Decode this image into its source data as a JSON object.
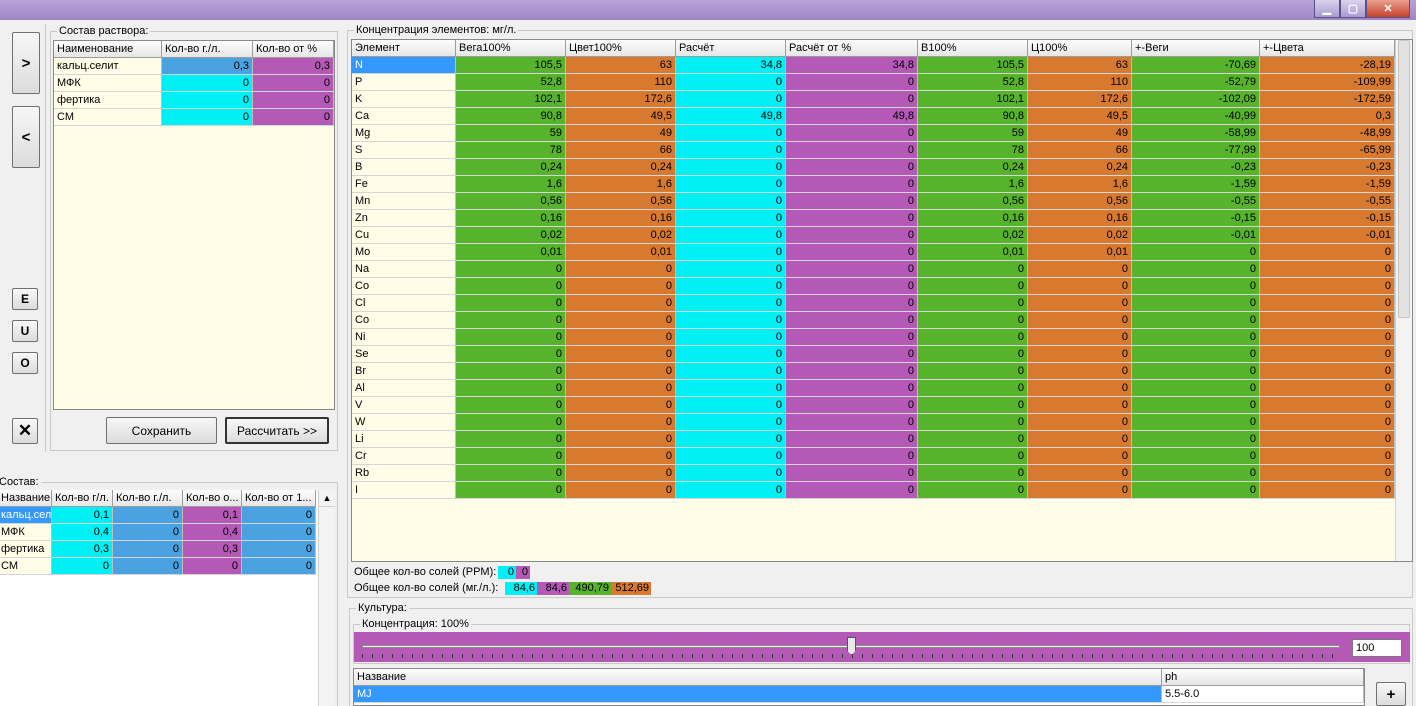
{
  "window": {
    "min_symbol": "▁",
    "max_symbol": "▢",
    "close_symbol": "✕"
  },
  "toolbar": {
    "add_label": ">",
    "remove_label": "<",
    "e_label": "E",
    "u_label": "U",
    "o_label": "O",
    "close_label": "✕"
  },
  "composition": {
    "title": "Состав раствора:",
    "headers": [
      "Наименование",
      "Кол-во г./л.",
      "Кол-во от %"
    ],
    "rows": [
      {
        "name": "кальц.селит",
        "g": "0,3",
        "pct": "0,3"
      },
      {
        "name": "МФК",
        "g": "0",
        "pct": "0"
      },
      {
        "name": "фертика",
        "g": "0",
        "pct": "0"
      },
      {
        "name": "СМ",
        "g": "0",
        "pct": "0"
      }
    ],
    "save_label": "Сохранить",
    "calc_label": "Рассчитать >>"
  },
  "sostav": {
    "title": "Состав:",
    "headers": [
      "Название",
      "Кол-во г/л.",
      "Кол-во г./л.",
      "Кол-во о...",
      "Кол-во от 1..."
    ],
    "rows": [
      {
        "name": "кальц.селит",
        "a": "0,1",
        "b": "0",
        "c": "0,1",
        "d": "0"
      },
      {
        "name": "МФК",
        "a": "0,4",
        "b": "0",
        "c": "0,4",
        "d": "0"
      },
      {
        "name": "фертика",
        "a": "0,3",
        "b": "0",
        "c": "0,3",
        "d": "0"
      },
      {
        "name": "СМ",
        "a": "0",
        "b": "0",
        "c": "0",
        "d": "0"
      }
    ]
  },
  "concentration": {
    "title": "Концентрация элементов: мг/л.",
    "headers": [
      "Элемент",
      "Вега100%",
      "Цвет100%",
      "Расчёт",
      "Расчёт от %",
      "В100%",
      "Ц100%",
      "+-Веги",
      "+-Цвета"
    ],
    "rows": [
      [
        "N",
        "105,5",
        "63",
        "34,8",
        "34,8",
        "105,5",
        "63",
        "-70,69",
        "-28,19"
      ],
      [
        "P",
        "52,8",
        "110",
        "0",
        "0",
        "52,8",
        "110",
        "-52,79",
        "-109,99"
      ],
      [
        "K",
        "102,1",
        "172,6",
        "0",
        "0",
        "102,1",
        "172,6",
        "-102,09",
        "-172,59"
      ],
      [
        "Ca",
        "90,8",
        "49,5",
        "49,8",
        "49,8",
        "90,8",
        "49,5",
        "-40,99",
        "0,3"
      ],
      [
        "Mg",
        "59",
        "49",
        "0",
        "0",
        "59",
        "49",
        "-58,99",
        "-48,99"
      ],
      [
        "S",
        "78",
        "66",
        "0",
        "0",
        "78",
        "66",
        "-77,99",
        "-65,99"
      ],
      [
        "B",
        "0,24",
        "0,24",
        "0",
        "0",
        "0,24",
        "0,24",
        "-0,23",
        "-0,23"
      ],
      [
        "Fe",
        "1,6",
        "1,6",
        "0",
        "0",
        "1,6",
        "1,6",
        "-1,59",
        "-1,59"
      ],
      [
        "Mn",
        "0,56",
        "0,56",
        "0",
        "0",
        "0,56",
        "0,56",
        "-0,55",
        "-0,55"
      ],
      [
        "Zn",
        "0,16",
        "0,16",
        "0",
        "0",
        "0,16",
        "0,16",
        "-0,15",
        "-0,15"
      ],
      [
        "Cu",
        "0,02",
        "0,02",
        "0",
        "0",
        "0,02",
        "0,02",
        "-0,01",
        "-0,01"
      ],
      [
        "Mo",
        "0,01",
        "0,01",
        "0",
        "0",
        "0,01",
        "0,01",
        "0",
        "0"
      ],
      [
        "Na",
        "0",
        "0",
        "0",
        "0",
        "0",
        "0",
        "0",
        "0"
      ],
      [
        "Co",
        "0",
        "0",
        "0",
        "0",
        "0",
        "0",
        "0",
        "0"
      ],
      [
        "Cl",
        "0",
        "0",
        "0",
        "0",
        "0",
        "0",
        "0",
        "0"
      ],
      [
        "Co",
        "0",
        "0",
        "0",
        "0",
        "0",
        "0",
        "0",
        "0"
      ],
      [
        "Ni",
        "0",
        "0",
        "0",
        "0",
        "0",
        "0",
        "0",
        "0"
      ],
      [
        "Se",
        "0",
        "0",
        "0",
        "0",
        "0",
        "0",
        "0",
        "0"
      ],
      [
        "Br",
        "0",
        "0",
        "0",
        "0",
        "0",
        "0",
        "0",
        "0"
      ],
      [
        "Al",
        "0",
        "0",
        "0",
        "0",
        "0",
        "0",
        "0",
        "0"
      ],
      [
        "V",
        "0",
        "0",
        "0",
        "0",
        "0",
        "0",
        "0",
        "0"
      ],
      [
        "W",
        "0",
        "0",
        "0",
        "0",
        "0",
        "0",
        "0",
        "0"
      ],
      [
        "Li",
        "0",
        "0",
        "0",
        "0",
        "0",
        "0",
        "0",
        "0"
      ],
      [
        "Cr",
        "0",
        "0",
        "0",
        "0",
        "0",
        "0",
        "0",
        "0"
      ],
      [
        "Rb",
        "0",
        "0",
        "0",
        "0",
        "0",
        "0",
        "0",
        "0"
      ],
      [
        "I",
        "0",
        "0",
        "0",
        "0",
        "0",
        "0",
        "0",
        "0"
      ]
    ],
    "column_colors": [
      "#fffde7",
      "#56b32b",
      "#d87930",
      "#00f0f5",
      "#b45ab6",
      "#56b32b",
      "#d87930",
      "#56b32b",
      "#d87930"
    ]
  },
  "summary": {
    "ppm_label": "Общее кол-во солей (PPM):",
    "ppm_values": [
      "0",
      "0"
    ],
    "mgl_label": "Общее кол-во солей (мг./л.):",
    "mgl_values": [
      "84,6",
      "84,6",
      "490,79",
      "512,69"
    ]
  },
  "culture": {
    "title": "Культура:",
    "conc_title": "Концентрация: 100%",
    "slider_fraction": 0.5,
    "conc_value": "100",
    "headers": [
      "Название",
      "ph"
    ],
    "rows": [
      {
        "name": "MJ",
        "ph": "5.5-6.0"
      }
    ],
    "add_label": "+"
  }
}
